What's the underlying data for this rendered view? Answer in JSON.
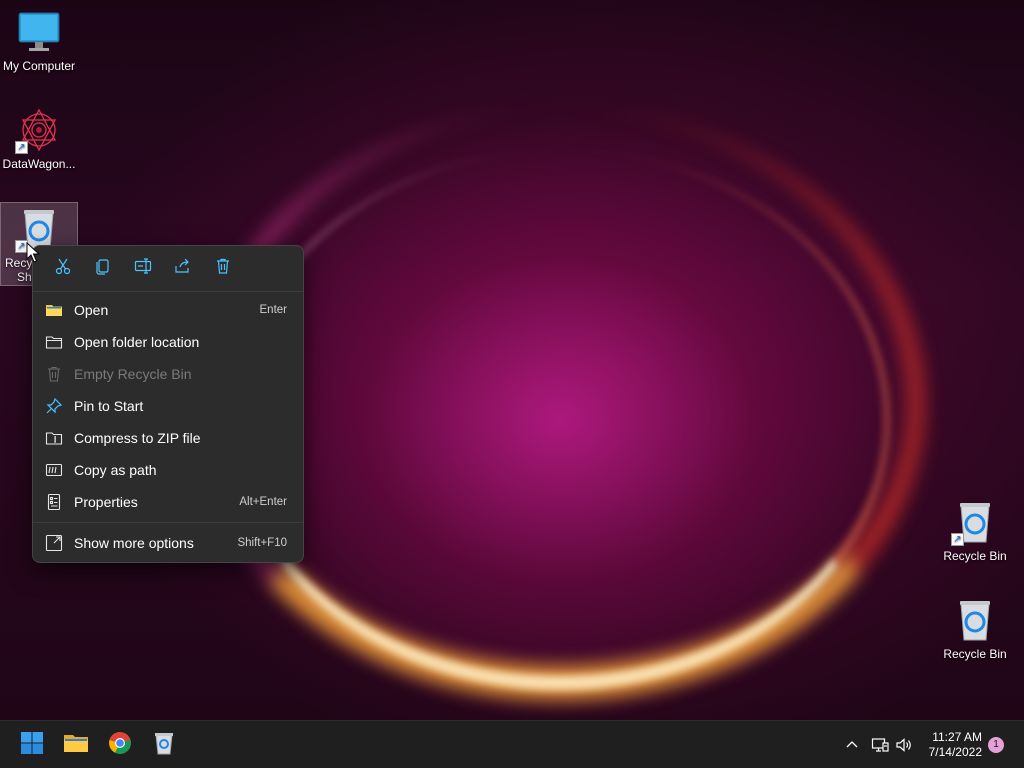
{
  "desktop": {
    "icons": [
      {
        "label": "My Computer",
        "icon": "monitor-icon"
      },
      {
        "label": "DataWagon...",
        "icon": "datawagon-icon"
      },
      {
        "label": "Recycle Bin Sh...",
        "visible_label_lines": [
          "Recyc",
          "Sh"
        ],
        "icon": "recycle-bin-shortcut-icon",
        "selected": true
      },
      {
        "label": "Recycle Bin",
        "icon": "recycle-bin-shortcut-icon"
      },
      {
        "label": "Recycle Bin",
        "icon": "recycle-bin-icon"
      }
    ]
  },
  "context_menu": {
    "quick_actions": [
      {
        "name": "cut",
        "icon": "cut-icon"
      },
      {
        "name": "copy",
        "icon": "copy-icon"
      },
      {
        "name": "rename",
        "icon": "rename-icon"
      },
      {
        "name": "share",
        "icon": "share-icon"
      },
      {
        "name": "delete",
        "icon": "delete-icon"
      }
    ],
    "items": [
      {
        "label": "Open",
        "shortcut": "Enter",
        "icon": "folder-open-icon",
        "enabled": true
      },
      {
        "label": "Open folder location",
        "shortcut": "",
        "icon": "folder-icon",
        "enabled": true
      },
      {
        "label": "Empty Recycle Bin",
        "shortcut": "",
        "icon": "trash-icon",
        "enabled": false
      },
      {
        "label": "Pin to Start",
        "shortcut": "",
        "icon": "pin-icon",
        "enabled": true
      },
      {
        "label": "Compress to ZIP file",
        "shortcut": "",
        "icon": "zip-icon",
        "enabled": true
      },
      {
        "label": "Copy as path",
        "shortcut": "",
        "icon": "copy-path-icon",
        "enabled": true
      },
      {
        "label": "Properties",
        "shortcut": "Alt+Enter",
        "icon": "properties-icon",
        "enabled": true
      }
    ],
    "more": {
      "label": "Show more options",
      "shortcut": "Shift+F10",
      "icon": "show-more-icon"
    }
  },
  "taskbar": {
    "apps": [
      {
        "name": "start",
        "icon": "windows-start-icon"
      },
      {
        "name": "file-explorer",
        "icon": "file-explorer-icon"
      },
      {
        "name": "chrome",
        "icon": "chrome-icon"
      },
      {
        "name": "recycle-bin",
        "icon": "recycle-bin-icon"
      }
    ],
    "tray": {
      "time": "11:27 AM",
      "date": "7/14/2022",
      "notification_count": "1"
    }
  },
  "colors": {
    "menu_bg": "#2c2c2c",
    "taskbar_bg": "#1f1f1f",
    "accent_blue": "#4cc2ff",
    "disabled_text": "#7a7a7a"
  }
}
